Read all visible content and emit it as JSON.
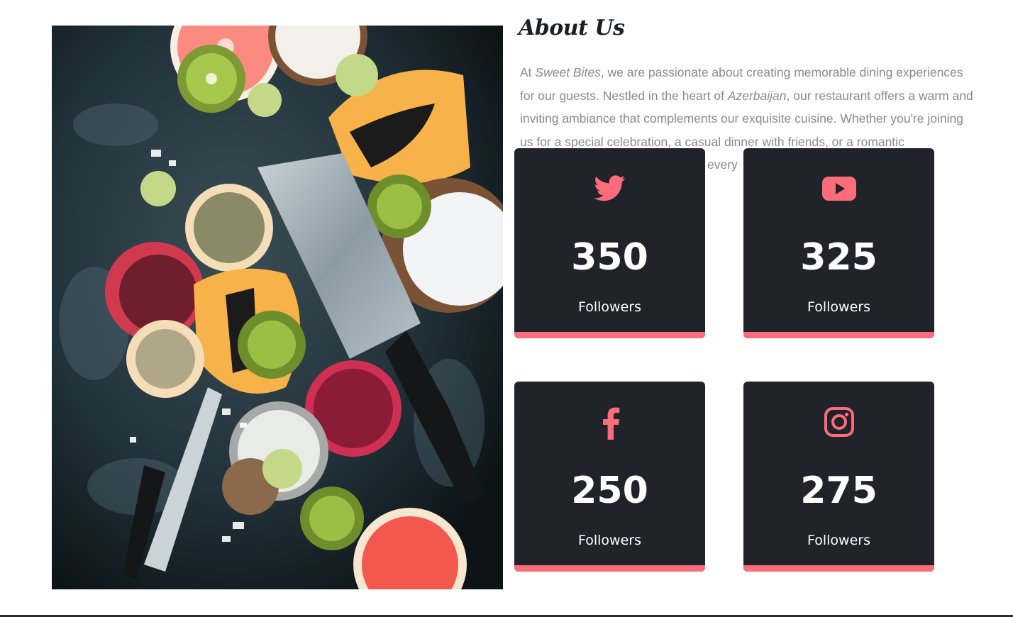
{
  "about": {
    "title": "About Us",
    "paragraph": {
      "p1": "At ",
      "brand": "Sweet Bites",
      "p2": ", we are passionate about creating memorable dining experiences for our guests. Nestled in the heart of ",
      "place": "Azerbaijan",
      "p3": ", our restaurant offers a warm and inviting ambiance that complements our exquisite cuisine. Whether you're joining us for a special celebration, a casual dinner with friends, or a romantic",
      "p4": "every"
    }
  },
  "stats": [
    {
      "network": "Twitter",
      "icon": "twitter-icon",
      "count": "350",
      "label": "Followers"
    },
    {
      "network": "YouTube",
      "icon": "youtube-icon",
      "count": "325",
      "label": "Followers"
    },
    {
      "network": "Facebook",
      "icon": "facebook-icon",
      "count": "250",
      "label": "Followers"
    },
    {
      "network": "Instagram",
      "icon": "instagram-icon",
      "count": "275",
      "label": "Followers"
    }
  ],
  "colors": {
    "accent": "#fc6c7b",
    "card_bg": "#20232a",
    "text_muted": "#8a8a8a",
    "heading": "#1c1e24"
  }
}
